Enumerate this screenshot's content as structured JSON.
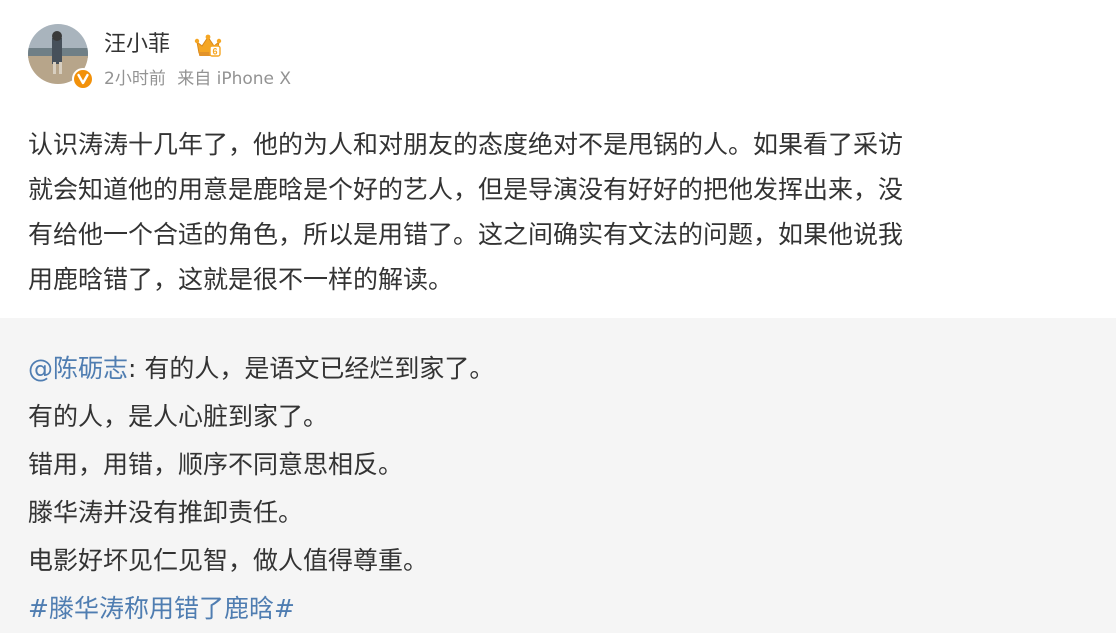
{
  "author": {
    "name": "汪小菲",
    "time": "2小时前",
    "source": "来自 iPhone X",
    "avatar_icon": "user-avatar",
    "verified_icon": "verified-v-badge",
    "member_icon": "crown-icon",
    "member_level": "6"
  },
  "post": {
    "lines": [
      "认识涛涛十几年了，他的为人和对朋友的态度绝对不是甩锅的人。如果看了采访",
      "就会知道他的用意是鹿晗是个好的艺人，但是导演没有好好的把他发挥出来，没",
      "有给他一个合适的角色，所以是用错了。这之间确实有文法的问题，如果他说我",
      "用鹿晗错了，这就是很不一样的解读。"
    ]
  },
  "repost": {
    "mention": "@陈砺志",
    "first_text": ": 有的人，是语文已经烂到家了。",
    "lines": [
      "有的人，是人心脏到家了。",
      "错用，用错，顺序不同意思相反。",
      "滕华涛并没有推卸责任。",
      "电影好坏见仁见智，做人值得尊重。"
    ],
    "hashtag": "#滕华涛称用错了鹿晗#"
  },
  "colors": {
    "link": "#4f7db1",
    "text": "#333333",
    "meta": "#939393",
    "repost_bg": "#f5f5f5",
    "crown": "#f5a623"
  }
}
